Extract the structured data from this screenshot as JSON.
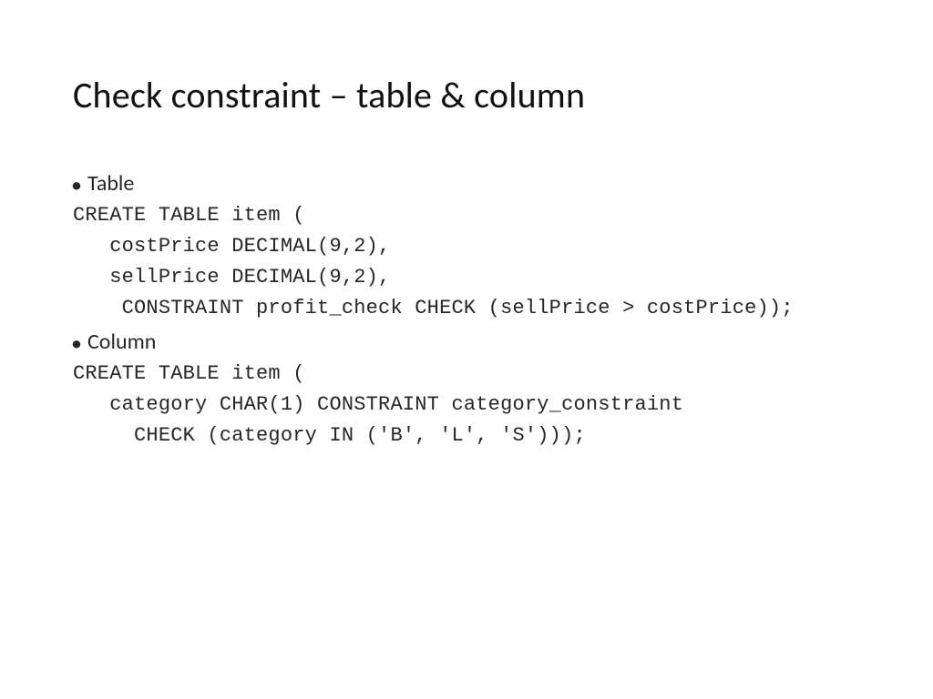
{
  "title": "Check constraint – table & column",
  "bullets": {
    "table": "Table",
    "column": "Column"
  },
  "code": {
    "table_l1": "CREATE TABLE item (",
    "table_l2": "   costPrice DECIMAL(9,2),",
    "table_l3": "   sellPrice DECIMAL(9,2),",
    "table_l4": "    CONSTRAINT profit_check CHECK (sellPrice > costPrice));",
    "column_l1": "CREATE TABLE item (",
    "column_l2": "   category CHAR(1) CONSTRAINT category_constraint",
    "column_l3": "     CHECK (category IN ('B', 'L', 'S')));"
  }
}
